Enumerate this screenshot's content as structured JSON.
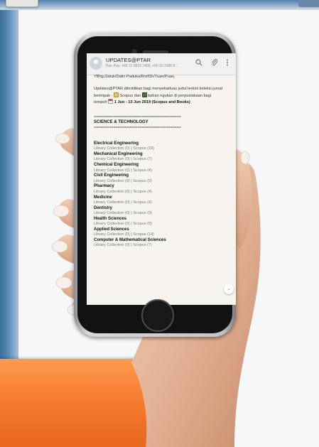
{
  "chat": {
    "title": "UPDATES@PTAR",
    "subtitle": "Pav, Pav, +60 11-2819 7403, +60 11-3285 9...",
    "messages": {
      "greeting": "YBhg.Datuk/Datin Paduka/Prof/Dr/Tuan/Puan,",
      "intro_part1": "Updates@PTAR diterbitkan bagi menyebarluas judul terkini koleksi jurnal berimpak - ",
      "intro_part2": " Scopus dan ",
      "intro_part3": " bahan rujukan di perpustakaan bagi tempoh ",
      "period": "1 Jun - 13 Jun 2019 (Scopus and Books)",
      "rule": "========================================",
      "section": "SCIENCE & TECHNOLOGY",
      "items": [
        {
          "title": "Electrical Engineering",
          "meta": "Library Collection (0) | Scopus (19)"
        },
        {
          "title": "Mechanical Engineering",
          "meta": "Library Collection (0) | Scopus (7)"
        },
        {
          "title": "Chemical Engineering",
          "meta": "Library Collection (0) | Scopus (4)"
        },
        {
          "title": "Civil Engineering",
          "meta": "Library Collection (0) | Scopus (9)"
        },
        {
          "title": "Pharmacy",
          "meta": "Library Collection (0) | Scopus (4)"
        },
        {
          "title": "Medicine",
          "meta": "Library Collection (0) | Scopus (4)"
        },
        {
          "title": "Dentistry",
          "meta": "Library Collection (0) | Scopus (0)"
        },
        {
          "title": "Health Sciences",
          "meta": "Library Collection (0) | Scopus (0)"
        },
        {
          "title": "Applied Sciences",
          "meta": "Library Collection (0) | Scopus (14)"
        },
        {
          "title": "Computer & Mathematical Sciences",
          "meta": "Library Collection (0) | Scopus (7)"
        }
      ]
    },
    "icons": {
      "search": "search-icon",
      "attach": "paperclip-icon",
      "menu": "kebab-menu-icon",
      "scroll": "chevron-down-icon"
    },
    "colors": {
      "chat_bg": "#f7f4ef",
      "header_bg": "#f0f0f0",
      "accent_orange": "#f3772c"
    }
  }
}
